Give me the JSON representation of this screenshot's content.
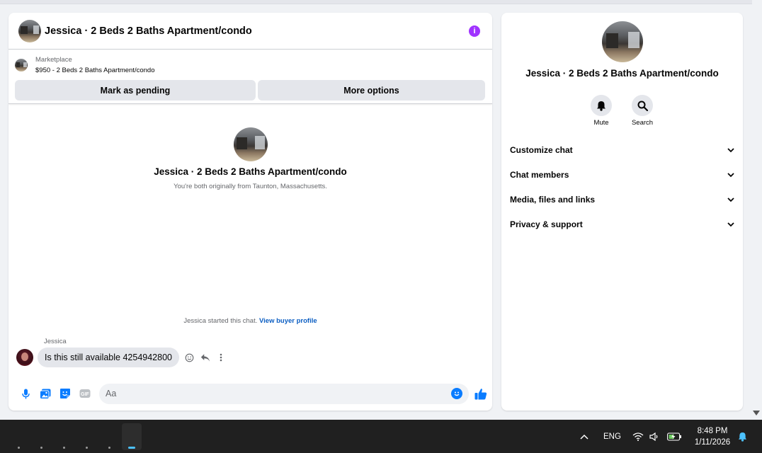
{
  "chat": {
    "title": "Jessica · 2 Beds 2 Baths Apartment/condo",
    "marketplace_label": "Marketplace",
    "listing": "$950 - 2 Beds 2 Baths Apartment/condo",
    "mark_pending_label": "Mark as pending",
    "more_options_label": "More options",
    "intro_title": "Jessica · 2 Beds 2 Baths Apartment/condo",
    "intro_subtitle": "You're both originally from Taunton, Massachusetts.",
    "started_text": "Jessica started this chat.",
    "buyer_profile_link": "View buyer profile",
    "message_sender": "Jessica",
    "message_text": "Is this still available 4254942800",
    "composer_placeholder": "Aa",
    "gif_label": "GIF",
    "info_glyph": "i"
  },
  "side": {
    "title": "Jessica · 2 Beds 2 Baths Apartment/condo",
    "mute_label": "Mute",
    "search_label": "Search",
    "items": [
      {
        "label": "Customize chat"
      },
      {
        "label": "Chat members"
      },
      {
        "label": "Media, files and links"
      },
      {
        "label": "Privacy & support"
      }
    ]
  },
  "taskbar": {
    "language": "ENG",
    "time": "8:48 PM",
    "date": "1/11/2026"
  },
  "colors": {
    "accent": "#0a7cff",
    "info": "#a033ff",
    "link": "#0a5dc2"
  },
  "icons": [
    "info-icon",
    "microphone-icon",
    "image-icon",
    "sticker-icon",
    "gif-icon",
    "emoji-icon",
    "like-icon",
    "bell-icon",
    "search-icon",
    "chevron-down-icon",
    "react-icon",
    "reply-icon",
    "more-icon",
    "wifi-icon",
    "volume-icon",
    "battery-icon",
    "notification-icon"
  ]
}
